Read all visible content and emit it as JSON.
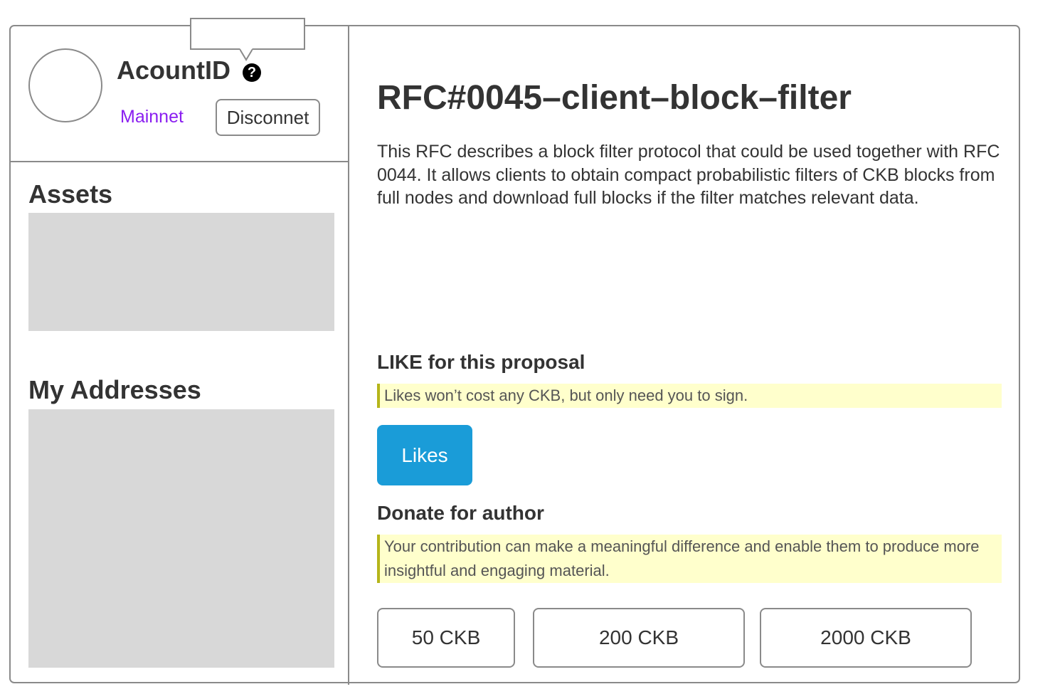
{
  "account": {
    "id_label": "AcountID",
    "help_glyph": "?",
    "network": "Mainnet",
    "disconnect_label": "Disconnet",
    "network_color": "#8a1ef0"
  },
  "sidebar": {
    "assets_heading": "Assets",
    "addresses_heading": "My Addresses"
  },
  "proposal": {
    "title": "RFC#0045–client–block–filter",
    "description": "This RFC describes a block filter protocol that could be used together with RFC 0044. It allows clients to obtain compact probabilistic filters of CKB blocks from full nodes and download full blocks if the filter matches relevant data."
  },
  "like_section": {
    "heading": "LIKE for this proposal",
    "note": "Likes won’t cost any CKB, but only need you to sign.",
    "button_label": "Likes",
    "button_color": "#1a9cd8"
  },
  "donate_section": {
    "heading": "Donate for author",
    "note": "Your contribution can make a meaningful difference and enable them to produce more insightful and engaging material.",
    "amounts": [
      "50 CKB",
      "200 CKB",
      "2000 CKB"
    ]
  },
  "colors": {
    "note_background": "#ffffcc",
    "note_border": "#b5b51a",
    "placeholder": "#d8d8d8"
  }
}
